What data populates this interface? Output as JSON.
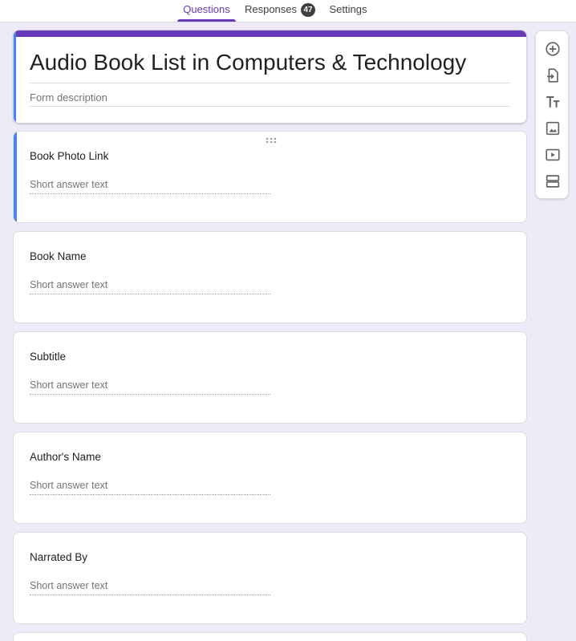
{
  "tabs": [
    {
      "label": "Questions",
      "active": true
    },
    {
      "label": "Responses",
      "badge": "47"
    },
    {
      "label": "Settings"
    }
  ],
  "form": {
    "title": "Audio Book List in Computers & Technology",
    "description_placeholder": "Form description"
  },
  "questions": [
    {
      "title": "Book Photo Link",
      "answer_placeholder": "Short answer text",
      "selected": true
    },
    {
      "title": "Book Name",
      "answer_placeholder": "Short answer text"
    },
    {
      "title": "Subtitle",
      "answer_placeholder": "Short answer text"
    },
    {
      "title": "Author's Name",
      "answer_placeholder": "Short answer text"
    },
    {
      "title": "Narrated By",
      "answer_placeholder": "Short answer text"
    }
  ],
  "toolbar": {
    "icons": [
      "add-question-icon",
      "import-questions-icon",
      "add-title-icon",
      "add-image-icon",
      "add-video-icon",
      "add-section-icon"
    ]
  },
  "colors": {
    "accent": "#673ab7",
    "selected_bar": "#4285f4",
    "background": "#efeaf8"
  }
}
